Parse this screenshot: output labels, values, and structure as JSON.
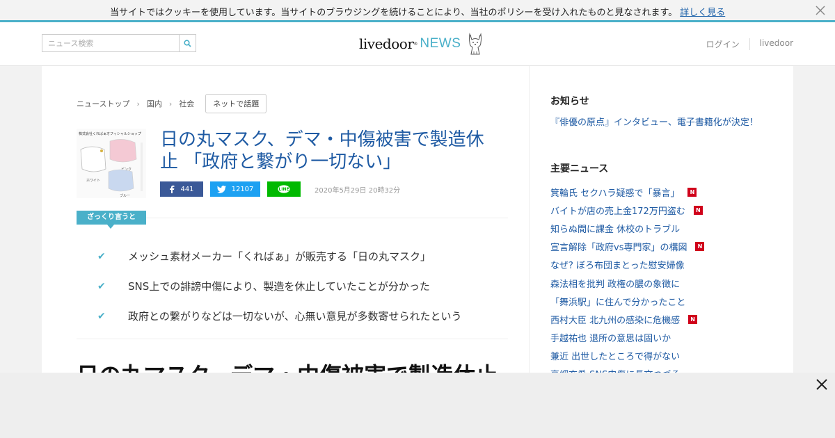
{
  "cookie": {
    "message": "当サイトではクッキーを使用しています。当サイトのブラウジングを続けることにより、当社のポリシーを受け入れたものと見なされます。",
    "link": "詳しく見る"
  },
  "header": {
    "search_placeholder": "ニュース検索",
    "logo_main": "livedoor",
    "logo_reg": "®",
    "logo_news": "NEWS",
    "login": "ログイン",
    "livedoor": "livedoor"
  },
  "breadcrumb": {
    "items": [
      "ニューストップ",
      "国内",
      "社会"
    ],
    "tag": "ネットで話題"
  },
  "article": {
    "title": "日の丸マスク、デマ・中傷被害で製造休止 「政府と繋がり一切ない」",
    "facebook_count": "441",
    "twitter_count": "12107",
    "line_label": "LINE",
    "date": "2020年5月29日 20時32分",
    "summary_label": "ざっくり言うと",
    "summary": [
      "メッシュ素材メーカー「くればぁ」が販売する「日の丸マスク」",
      "SNS上での誹謗中傷により、製造を休止していたことが分かった",
      "政府との繋がりなどは一切ないが、心無い意見が多数寄せられたという"
    ],
    "body_title": "日の丸マスク、デマ・中傷被害で製造休止",
    "thumb": {
      "banner": "株式会社くればぁオフィシャルショップ",
      "pink": "ピンク",
      "white": "ホワイト",
      "blue": "ブルー"
    }
  },
  "sidebar": {
    "notice_heading": "お知らせ",
    "notice_link": "『俳優の原点』インタビュー、電子書籍化が決定！",
    "news_heading": "主要ニュース",
    "news_badge": "N",
    "news": [
      {
        "title": "箕輪氏 セクハラ疑惑で「暴言」",
        "badge": true
      },
      {
        "title": "バイトが店の売上金172万円盗む",
        "badge": true
      },
      {
        "title": "知らぬ間に課金 休校のトラブル",
        "badge": false
      },
      {
        "title": "宣言解除「政府vs専門家」の構図",
        "badge": true
      },
      {
        "title": "なぜ? ぼろ布団まとった慰安婦像",
        "badge": false
      },
      {
        "title": "森法相を批判 政権の膿の象徴に",
        "badge": false
      },
      {
        "title": "「舞浜駅」に住んで分かったこと",
        "badge": false
      },
      {
        "title": "西村大臣 北九州の感染に危機感",
        "badge": true
      },
      {
        "title": "手越祐也 退所の意思は固いか",
        "badge": false
      },
      {
        "title": "兼近 出世したところで得がない",
        "badge": false
      },
      {
        "title": "高畑充希 SNS中傷に長文つづる",
        "badge": false
      }
    ]
  },
  "colors": {
    "accent": "#4ab0c9",
    "link": "#1e5aa3",
    "facebook": "#3b5998",
    "twitter": "#1da1f2",
    "line": "#00b900",
    "badge": "#d0021b"
  }
}
